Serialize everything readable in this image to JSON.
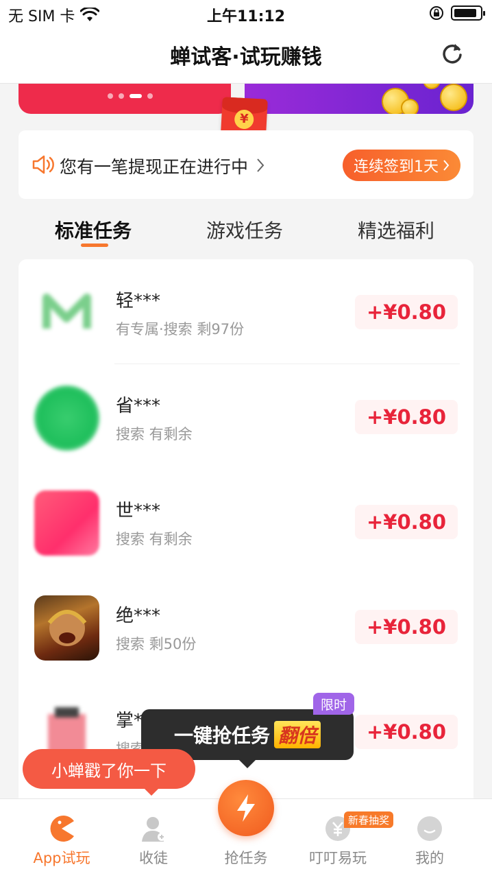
{
  "status_bar": {
    "carrier": "无 SIM 卡",
    "time": "上午11:12"
  },
  "nav": {
    "title": "蝉试客·试玩赚钱"
  },
  "notice": {
    "text": "您有一笔提现正在进行中",
    "checkin_label": "连续签到1天"
  },
  "tabs": [
    {
      "label": "标准任务",
      "active": true
    },
    {
      "label": "游戏任务",
      "active": false
    },
    {
      "label": "精选福利",
      "active": false
    }
  ],
  "tasks": [
    {
      "name": "轻***",
      "desc": "有专属·搜索 剩97份",
      "reward": "+¥0.80",
      "icon": "app-icon-m"
    },
    {
      "name": "省***",
      "desc": "搜索 有剩余",
      "reward": "+¥0.80",
      "icon": "app-icon-green"
    },
    {
      "name": "世***",
      "desc": "搜索 有剩余",
      "reward": "+¥0.80",
      "icon": "app-icon-pink"
    },
    {
      "name": "绝***",
      "desc": "搜索 剩50份",
      "reward": "+¥0.80",
      "icon": "app-icon-hero"
    },
    {
      "name": "掌***",
      "desc": "搜索 剩96份",
      "reward": "+¥0.80",
      "icon": "app-icon-blurred"
    }
  ],
  "promo": {
    "grab_text": "一键抢任务",
    "double_text": "翻倍",
    "limited_tag": "限时",
    "poke_text": "小蝉戳了你一下"
  },
  "tab_bar": {
    "items": [
      {
        "label": "App试玩",
        "active": true,
        "icon": "pacman-icon"
      },
      {
        "label": "收徒",
        "active": false,
        "icon": "add-user-icon"
      },
      {
        "label": "抢任务",
        "active": false,
        "icon": "lightning-icon"
      },
      {
        "label": "叮叮易玩",
        "active": false,
        "icon": "yuan-coin-icon"
      },
      {
        "label": "我的",
        "active": false,
        "icon": "profile-icon"
      }
    ],
    "lottery_tag": "新春抽奖"
  },
  "colors": {
    "accent": "#f7772e",
    "reward": "#e8243a",
    "banner_red": "#ee2b4b",
    "banner_purple": "#7a25d4"
  }
}
